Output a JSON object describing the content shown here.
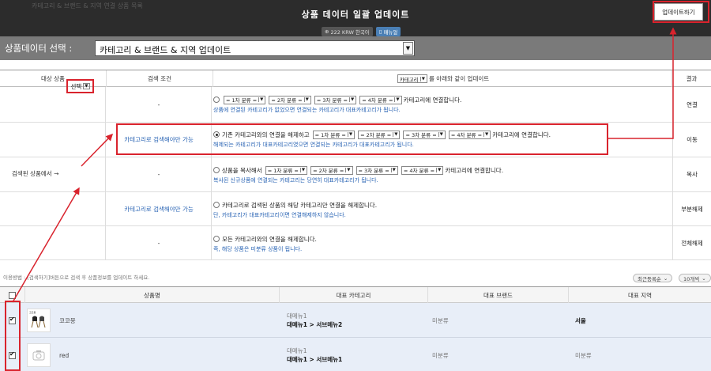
{
  "header": {
    "title": "상품 데이터 일괄 업데이트",
    "update_button": "업데이트하기",
    "bg_ghost_text": "카테고리 & 브랜드 & 지역 연결 상품 목록",
    "currency_pill": "222 KRW 한국어",
    "manual_pill": "매뉴얼"
  },
  "selector": {
    "label": "상품데이터 선택 :",
    "value": "카테고리 & 브랜드 & 지역 업데이트"
  },
  "table": {
    "headers": {
      "target": "대상 상품",
      "condition": "검색 조건",
      "category_select": "카테고리",
      "update_suffix": "를 아래와 같이 업데이트",
      "result": "결과"
    },
    "left_label": "검색된 상품에서 →",
    "left_select": "선택",
    "cat1": "= 1차 분류 =",
    "cat2": "= 2차 분류 =",
    "cat3": "= 3차 분류 =",
    "cat4": "= 4차 분류 =",
    "rows": [
      {
        "condition": "-",
        "prefix": "",
        "suffix": "카테고리에 연결합니다.",
        "note": "상품에 연결된 카테고리가 없었으면 연결되는 카테고리가 대표카테고리가 됩니다.",
        "result": "연결"
      },
      {
        "condition": "카테고리로 검색해야만 가능",
        "prefix": "기존 카테고리와의 연결을 해제하고",
        "suffix": "카테고리에 연결합니다.",
        "note": "해제되는 카테고리가 대표카테고리였으면 연결되는 카테고리가 대표카테고리가 됩니다.",
        "result": "이동"
      },
      {
        "condition": "-",
        "prefix": "상품을 복사해서",
        "suffix": "카테고리에 연결합니다.",
        "note": "복사된 신규상품에 연결되는 카테고리는 당연히 대표카테고리가 됩니다.",
        "result": "복사"
      },
      {
        "condition": "카테고리로 검색해야만 가능",
        "prefix": "카테고리로 검색된 상품의 해당 카테고리만 연결을 해제합니다.",
        "suffix": "",
        "note": "단, 카테고리가 대표카테고리이면 연결해제하지 않습니다.",
        "result": "부분해제"
      },
      {
        "condition": "-",
        "prefix": "모든 카테고리와의 연결을 해제합니다.",
        "suffix": "",
        "note": "즉, 해당 상품은 미분류 상품이 됩니다.",
        "result": "전체해제"
      }
    ]
  },
  "help_text": "이용방법 : [검색하기]버튼으로 검색 후 상품정보를 업데이트 하세요.",
  "sort": {
    "order": "최근등록순",
    "count": "10개씩"
  },
  "product_list": {
    "headers": {
      "name": "상품명",
      "category": "대표 카테고리",
      "brand": "대표 브랜드",
      "region": "대표 지역"
    },
    "rows": [
      {
        "name": "코코몽",
        "category_top": "대메뉴1",
        "category_path": "대메뉴1 > 서브메뉴2",
        "brand": "미분류",
        "region": "서울",
        "checked": true,
        "thumb_icon": "chair-thumbnail",
        "thumb_caption": "코코몽"
      },
      {
        "name": "red",
        "category_top": "대메뉴1",
        "category_path": "대메뉴1 > 서브메뉴1",
        "brand": "미분류",
        "region": "미분류",
        "checked": true,
        "thumb_icon": "camera-placeholder-icon",
        "thumb_caption": ""
      }
    ]
  },
  "colors": {
    "annotation_red": "#d9232d",
    "header_bg": "#2c2c2c",
    "select_bar_bg": "#7a7a7a",
    "row_highlight": "#e8eef8",
    "link_blue": "#2a64b4"
  }
}
